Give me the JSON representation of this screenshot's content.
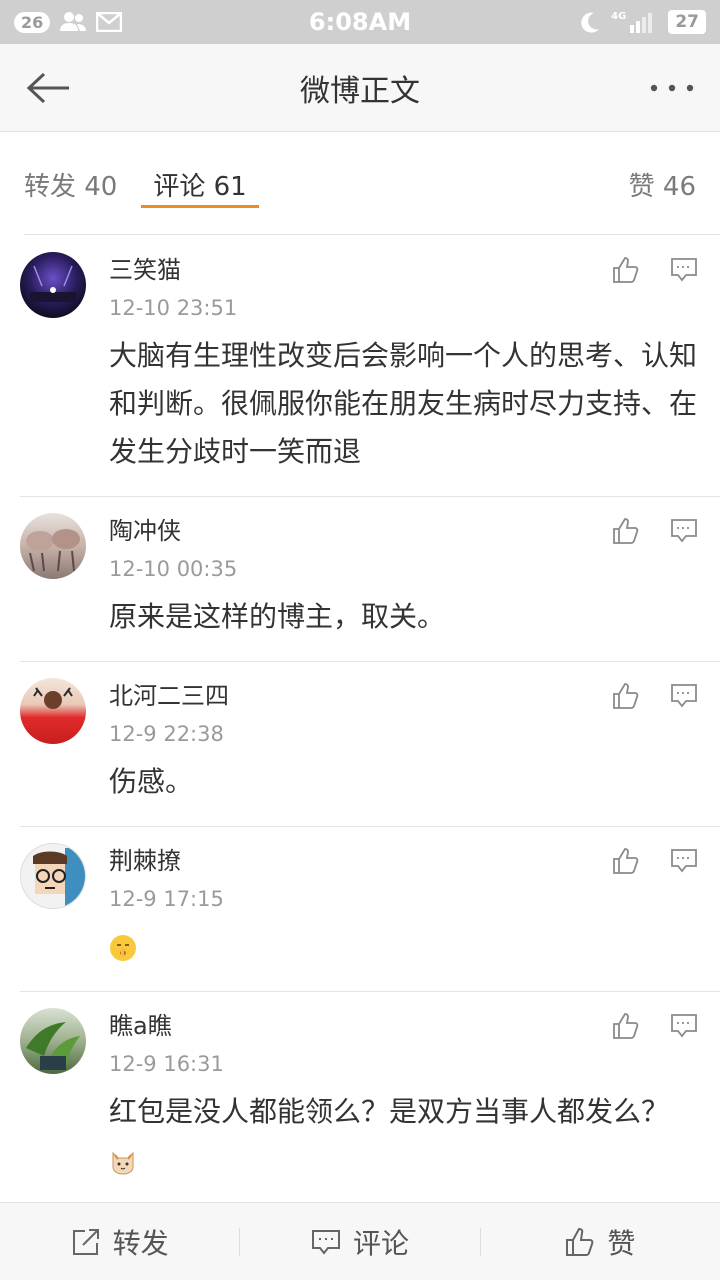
{
  "status_bar": {
    "notification_count": "26",
    "time": "6:08AM",
    "network": "4G",
    "battery": "27"
  },
  "header": {
    "title": "微博正文"
  },
  "tabs": [
    {
      "label": "转发 40"
    },
    {
      "label": "评论 61"
    },
    {
      "label": "赞 46"
    }
  ],
  "comments": [
    {
      "name": "三笑猫",
      "time": "12-10 23:51",
      "text": "大脑有生理性改变后会影响一个人的思考、认知和判断。很佩服你能在朋友生病时尽力支持、在发生分歧时一笑而退"
    },
    {
      "name": "陶冲侠",
      "time": "12-10 00:35",
      "text": "原来是这样的博主，取关。"
    },
    {
      "name": "北河二三四",
      "time": "12-9 22:38",
      "text": "伤感。"
    },
    {
      "name": "荆棘撩",
      "time": "12-9 17:15",
      "text": ""
    },
    {
      "name": "瞧a瞧",
      "time": "12-9 16:31",
      "text": "红包是没人都能领么？是双方当事人都发么？"
    }
  ],
  "bottom_bar": {
    "repost": "转发",
    "comment": "评论",
    "like": "赞"
  },
  "colors": {
    "accent": "#f08c1f"
  }
}
